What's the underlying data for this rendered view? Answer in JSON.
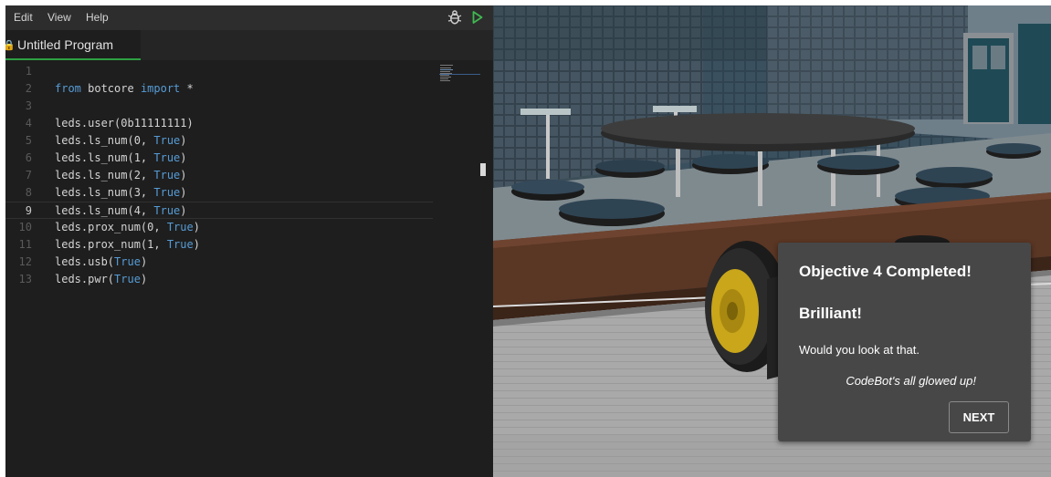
{
  "menu": {
    "edit": "Edit",
    "view": "View",
    "help": "Help"
  },
  "toolbar": {
    "debug_icon": "bug-icon",
    "run_icon": "play-icon"
  },
  "tab": {
    "label": "Untitled Program",
    "icon": "lock-icon"
  },
  "editor": {
    "current_line": 9,
    "lines": [
      {
        "num": "1",
        "text": ""
      },
      {
        "num": "2",
        "text": "from botcore import *"
      },
      {
        "num": "3",
        "text": ""
      },
      {
        "num": "4",
        "text": "leds.user(0b11111111)"
      },
      {
        "num": "5",
        "text": "leds.ls_num(0, True)"
      },
      {
        "num": "6",
        "text": "leds.ls_num(1, True)"
      },
      {
        "num": "7",
        "text": "leds.ls_num(2, True)"
      },
      {
        "num": "8",
        "text": "leds.ls_num(3, True)"
      },
      {
        "num": "9",
        "text": "leds.ls_num(4, True)"
      },
      {
        "num": "10",
        "text": "leds.prox_num(0, True)"
      },
      {
        "num": "11",
        "text": "leds.prox_num(1, True)"
      },
      {
        "num": "12",
        "text": "leds.usb(True)"
      },
      {
        "num": "13",
        "text": "leds.pwr(True)"
      }
    ]
  },
  "dialog": {
    "title": "Objective 4 Completed!",
    "subtitle": "Brilliant!",
    "message": "Would you look at that.",
    "quote": "CodeBot's all glowed up!",
    "next_label": "NEXT"
  },
  "colors": {
    "keyword": "#569cd6",
    "tab_accent": "#2ea043",
    "run": "#3fb950",
    "dialog_bg": "#474747"
  }
}
